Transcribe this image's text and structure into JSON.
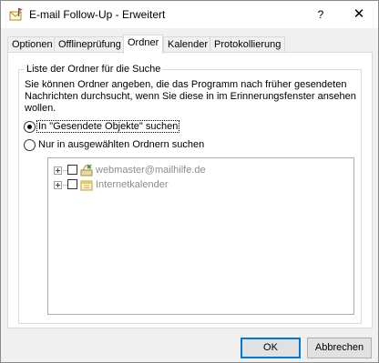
{
  "window": {
    "title": "E-mail Follow-Up - Erweitert",
    "help_label": "?",
    "close_label": "✕"
  },
  "tabs": [
    {
      "label": "Optionen",
      "active": false
    },
    {
      "label": "Offlineprüfung",
      "active": false
    },
    {
      "label": "Ordner",
      "active": true
    },
    {
      "label": "Kalender",
      "active": false
    },
    {
      "label": "Protokollierung",
      "active": false
    }
  ],
  "group": {
    "legend": "Liste der Ordner für die Suche",
    "description": "Sie können Ordner angeben, die das Programm nach früher gesendeten Nachrichten durchsucht, wenn Sie diese in im Erinnerungsfenster ansehen wollen."
  },
  "options": [
    {
      "label": "In \"Gesendete Objekte\" suchen",
      "checked": true
    },
    {
      "label": "Nur in ausgewählten Ordnern suchen",
      "checked": false
    }
  ],
  "tree": {
    "items": [
      {
        "label": "webmaster@mailhilfe.de",
        "checked": false,
        "icon": "mailbox-icon"
      },
      {
        "label": "Internetkalender",
        "checked": false,
        "icon": "calendar-icon"
      }
    ]
  },
  "buttons": {
    "ok_label": "OK",
    "cancel_label": "Abbrechen"
  },
  "colors": {
    "accent": "#0078d7",
    "disabled_text": "#8c8c8c"
  }
}
